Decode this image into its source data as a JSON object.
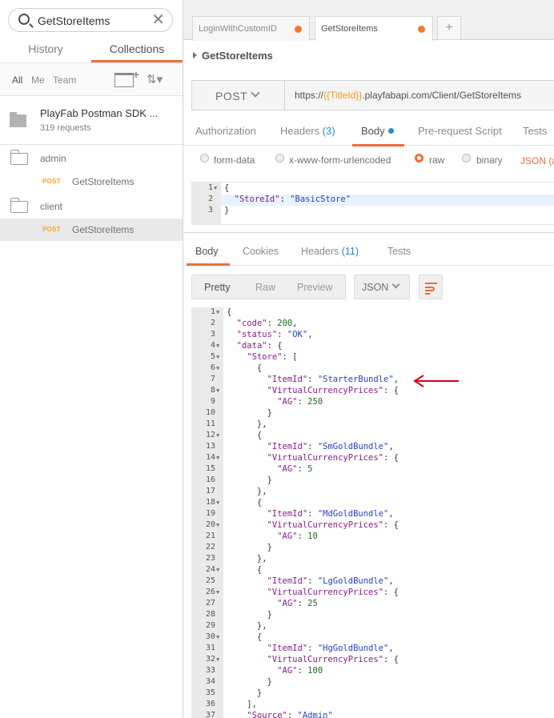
{
  "sidebar": {
    "search": {
      "value": "GetStoreItems"
    },
    "tabs": [
      "History",
      "Collections"
    ],
    "filters": [
      "All",
      "Me",
      "Team"
    ],
    "collection": {
      "name": "PlayFab Postman SDK ...",
      "count": "319 requests"
    },
    "folders": [
      {
        "name": "admin",
        "request": {
          "method": "POST",
          "name": "GetStoreItems"
        }
      },
      {
        "name": "client",
        "request": {
          "method": "POST",
          "name": "GetStoreItems"
        }
      }
    ]
  },
  "main": {
    "tabs": [
      {
        "label": "LoginWithCustomID"
      },
      {
        "label": "GetStoreItems"
      }
    ],
    "add_tab_label": "+",
    "request_title": "GetStoreItems",
    "method": "POST",
    "url": {
      "prefix": "https://",
      "variable": "{{TitleId}}",
      "suffix": ".playfabapi.com/Client/GetStoreItems"
    },
    "request_tabs": {
      "authorization": "Authorization",
      "headers": "Headers",
      "headers_count": "(3)",
      "body": "Body",
      "pre_request": "Pre-request Script",
      "tests": "Tests"
    },
    "body_modes": [
      "form-data",
      "x-www-form-urlencoded",
      "raw",
      "binary"
    ],
    "raw_type": "JSON (a",
    "request_body": [
      {
        "n": "1",
        "t": "{"
      },
      {
        "n": "2",
        "t": "  \"StoreId\": \"BasicStore\""
      },
      {
        "n": "3",
        "t": "}"
      }
    ],
    "response_tabs": {
      "body": "Body",
      "cookies": "Cookies",
      "headers": "Headers",
      "headers_count": "(11)",
      "tests": "Tests"
    },
    "view_modes": [
      "Pretty",
      "Raw",
      "Preview"
    ],
    "format": "JSON",
    "response_body": [
      {
        "n": "1",
        "t": "{"
      },
      {
        "n": "2",
        "t": "  \"code\": 200,"
      },
      {
        "n": "3",
        "t": "  \"status\": \"OK\","
      },
      {
        "n": "4",
        "t": "  \"data\": {"
      },
      {
        "n": "5",
        "t": "    \"Store\": ["
      },
      {
        "n": "6",
        "t": "      {"
      },
      {
        "n": "7",
        "t": "        \"ItemId\": \"StarterBundle\","
      },
      {
        "n": "8",
        "t": "        \"VirtualCurrencyPrices\": {"
      },
      {
        "n": "9",
        "t": "          \"AG\": 250"
      },
      {
        "n": "10",
        "t": "        }"
      },
      {
        "n": "11",
        "t": "      },"
      },
      {
        "n": "12",
        "t": "      {"
      },
      {
        "n": "13",
        "t": "        \"ItemId\": \"SmGoldBundle\","
      },
      {
        "n": "14",
        "t": "        \"VirtualCurrencyPrices\": {"
      },
      {
        "n": "15",
        "t": "          \"AG\": 5"
      },
      {
        "n": "16",
        "t": "        }"
      },
      {
        "n": "17",
        "t": "      },"
      },
      {
        "n": "18",
        "t": "      {"
      },
      {
        "n": "19",
        "t": "        \"ItemId\": \"MdGoldBundle\","
      },
      {
        "n": "20",
        "t": "        \"VirtualCurrencyPrices\": {"
      },
      {
        "n": "21",
        "t": "          \"AG\": 10"
      },
      {
        "n": "22",
        "t": "        }"
      },
      {
        "n": "23",
        "t": "      },"
      },
      {
        "n": "24",
        "t": "      {"
      },
      {
        "n": "25",
        "t": "        \"ItemId\": \"LgGoldBundle\","
      },
      {
        "n": "26",
        "t": "        \"VirtualCurrencyPrices\": {"
      },
      {
        "n": "27",
        "t": "          \"AG\": 25"
      },
      {
        "n": "28",
        "t": "        }"
      },
      {
        "n": "29",
        "t": "      },"
      },
      {
        "n": "30",
        "t": "      {"
      },
      {
        "n": "31",
        "t": "        \"ItemId\": \"HgGoldBundle\","
      },
      {
        "n": "32",
        "t": "        \"VirtualCurrencyPrices\": {"
      },
      {
        "n": "33",
        "t": "          \"AG\": 100"
      },
      {
        "n": "34",
        "t": "        }"
      },
      {
        "n": "35",
        "t": "      }"
      },
      {
        "n": "36",
        "t": "    ],"
      },
      {
        "n": "37",
        "t": "    \"Source\": \"Admin\""
      }
    ],
    "fold_lines": [
      "1",
      "4",
      "5",
      "6",
      "8",
      "12",
      "14",
      "18",
      "20",
      "24",
      "26",
      "30",
      "32"
    ]
  },
  "colors": {
    "accent": "#f26b3a",
    "method_post": "#f6a623",
    "url_variable": "#f39c12",
    "count_blue": "#2b8ad6",
    "annotation_arrow": "#d0021b"
  }
}
